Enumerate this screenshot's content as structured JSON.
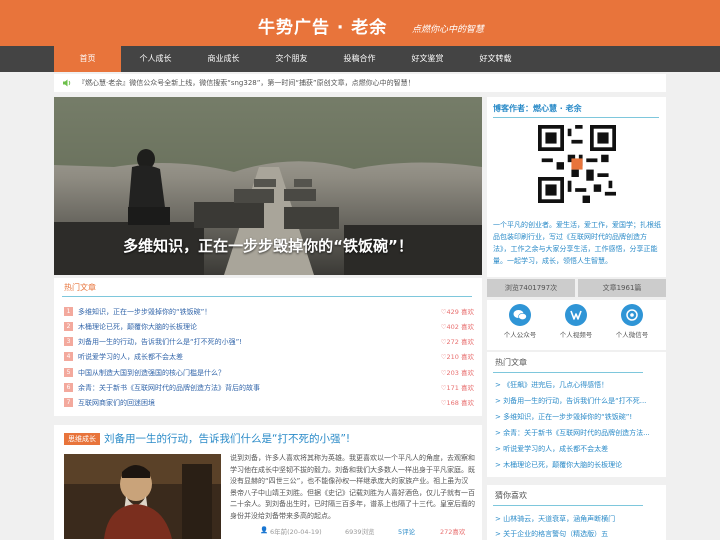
{
  "header": {
    "title": "牛势广告 · 老余",
    "slogan": "点燃你心中的智慧"
  },
  "nav": {
    "items": [
      {
        "label": "首页",
        "active": true
      },
      {
        "label": "个人成长"
      },
      {
        "label": "商业成长"
      },
      {
        "label": "交个朋友"
      },
      {
        "label": "投稿合作"
      },
      {
        "label": "好文鉴赏"
      },
      {
        "label": "好文转载"
      }
    ]
  },
  "notice": {
    "icon": "speaker-icon",
    "text": "『燃心慧·老余』微信公众号全新上线，微信搜索“sng328”，第一时间“捕获”原创文章，点燃你心中的智慧！"
  },
  "hero": {
    "caption": "多维知识，正在一步步毁掉你的“铁饭碗”！"
  },
  "hot": {
    "title": "热门文章",
    "items": [
      {
        "num": "1",
        "text": "多维知识，正在一步步毁掉你的“铁饭碗”！",
        "likes": "♡429 喜欢"
      },
      {
        "num": "2",
        "text": "木桶理论已死，颠覆你大脑的长板理论",
        "likes": "♡402 喜欢"
      },
      {
        "num": "3",
        "text": "刘备用一生的行动，告诉我们什么是“打不死的小强”!",
        "likes": "♡272 喜欢"
      },
      {
        "num": "4",
        "text": "听说爱学习的人，成长都不会太差",
        "likes": "♡210 喜欢"
      },
      {
        "num": "5",
        "text": "中国从制造大国到创造强国的核心门槛是什么？",
        "likes": "♡203 喜欢"
      },
      {
        "num": "6",
        "text": "余青：关于新书《互联网时代的品牌创造方法》背后的故事",
        "likes": "♡171 喜欢"
      },
      {
        "num": "7",
        "text": "互联网商家们的回迷困境",
        "likes": "♡168 喜欢"
      }
    ]
  },
  "article": {
    "category": "思维成长",
    "title": "刘备用一生的行动，告诉我们什么是“打不死的小强”!",
    "excerpt": "说到刘备，许多人喜欢将其称为英雄。我更喜欢以一个平凡人的角度，去观察和学习他在成长中坚韧不拔的毅力。刘备和我们大多数人一样出身于平凡家庭。既没有显赫的“四世三公”，也不能像孙权一样继承庞大的家族产业。祖上虽为汉景帝八子中山靖王刘胜。但据《史记》记载刘胜为人喜好酒色，仅儿子就有一百二十余人。到刘备出生时，已时隔三百多年，谱系上也隔了十三代。皇室后裔的身份并没给刘备带来多高的起点。",
    "author": "6年前(20-04-19)",
    "views": "6939浏览",
    "comments": "5评论",
    "likes": "272喜欢"
  },
  "author_box": {
    "title": "博客作者：燃心慧 · 老余",
    "bio": "一个平凡的创业者。爱生活，爱工作，爱国学；扎根纸品包装印刷行业，写过《互联网时代的品牌创造方法》，工作之余与大家分享生活，工作感悟，分享正能量。一起学习，成长，领悟人生智慧。"
  },
  "stats": {
    "views": "浏览7401797次",
    "articles": "文章1961篇"
  },
  "social": [
    {
      "label": "个人公众号",
      "icon": "wechat-icon"
    },
    {
      "label": "个人视频号",
      "icon": "video-channel-icon"
    },
    {
      "label": "个人微信号",
      "icon": "wechat-personal-icon"
    }
  ],
  "side_hot": {
    "title": "热门文章",
    "items": [
      "> 《狂飙》进完后，几点心得感悟！",
      "> 刘备用一生的行动，告诉我们什么是“打不死...",
      "> 多维知识，正在一步步毁掉你的“铁饭碗”!",
      "> 余青：关于新书《互联网时代的品牌创造方法...",
      "> 听说爱学习的人，成长都不会太差",
      "> 木桶理论已死，颠覆你大脑的长板理论"
    ]
  },
  "guess": {
    "title": "猜你喜欢",
    "items": [
      "> 山林骑云，天道衰草，涵角声断横门",
      "> 关于企业的格言警句（精选版）五"
    ]
  },
  "colors": {
    "accent": "#e8743b",
    "nav_bg": "#444444",
    "link": "#2b8bc8"
  }
}
